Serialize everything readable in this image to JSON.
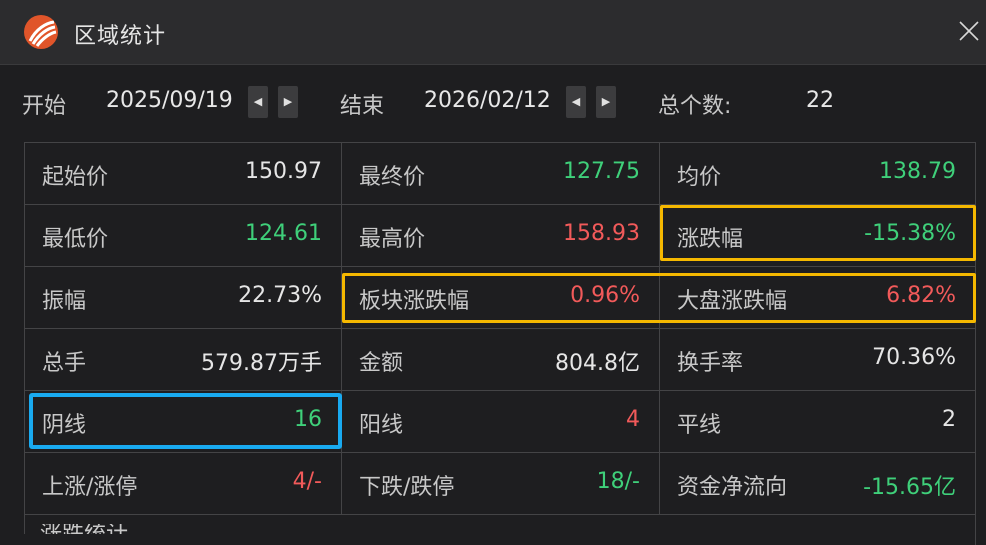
{
  "window": {
    "title": "区域统计",
    "logo_icon": "app-logo-icon",
    "close_icon": "close-icon"
  },
  "filter": {
    "start_label": "开始",
    "start_date": "2025/09/19",
    "end_label": "结束",
    "end_date": "2026/02/12",
    "count_label": "总个数:",
    "count_value": "22"
  },
  "stats": [
    [
      {
        "label": "起始价",
        "value": "150.97",
        "color": "neutral"
      },
      {
        "label": "最终价",
        "value": "127.75",
        "color": "green"
      },
      {
        "label": "均价",
        "value": "138.79",
        "color": "green"
      }
    ],
    [
      {
        "label": "最低价",
        "value": "124.61",
        "color": "green"
      },
      {
        "label": "最高价",
        "value": "158.93",
        "color": "red"
      },
      {
        "label": "涨跌幅",
        "value": "-15.38%",
        "color": "green"
      }
    ],
    [
      {
        "label": "振幅",
        "value": "22.73%",
        "color": "neutral"
      },
      {
        "label": "板块涨跌幅",
        "value": "0.96%",
        "color": "red"
      },
      {
        "label": "大盘涨跌幅",
        "value": "6.82%",
        "color": "red"
      }
    ],
    [
      {
        "label": "总手",
        "value": "579.87万手",
        "color": "neutral"
      },
      {
        "label": "金额",
        "value": "804.8亿",
        "color": "neutral"
      },
      {
        "label": "换手率",
        "value": "70.36%",
        "color": "neutral"
      }
    ],
    [
      {
        "label": "阴线",
        "value": "16",
        "color": "green"
      },
      {
        "label": "阳线",
        "value": "4",
        "color": "red"
      },
      {
        "label": "平线",
        "value": "2",
        "color": "neutral"
      }
    ],
    [
      {
        "label": "上涨/涨停",
        "value": "4/-",
        "color": "red"
      },
      {
        "label": "下跌/跌停",
        "value": "18/-",
        "color": "green"
      },
      {
        "label": "资金净流向",
        "value": "-15.65亿",
        "color": "green"
      }
    ]
  ],
  "colors": {
    "green": "#3fd07a",
    "red": "#f25a5a",
    "highlight_yellow": "#f5b800",
    "highlight_blue": "#19aaf0"
  },
  "partial_row_label": "涨跌统计"
}
